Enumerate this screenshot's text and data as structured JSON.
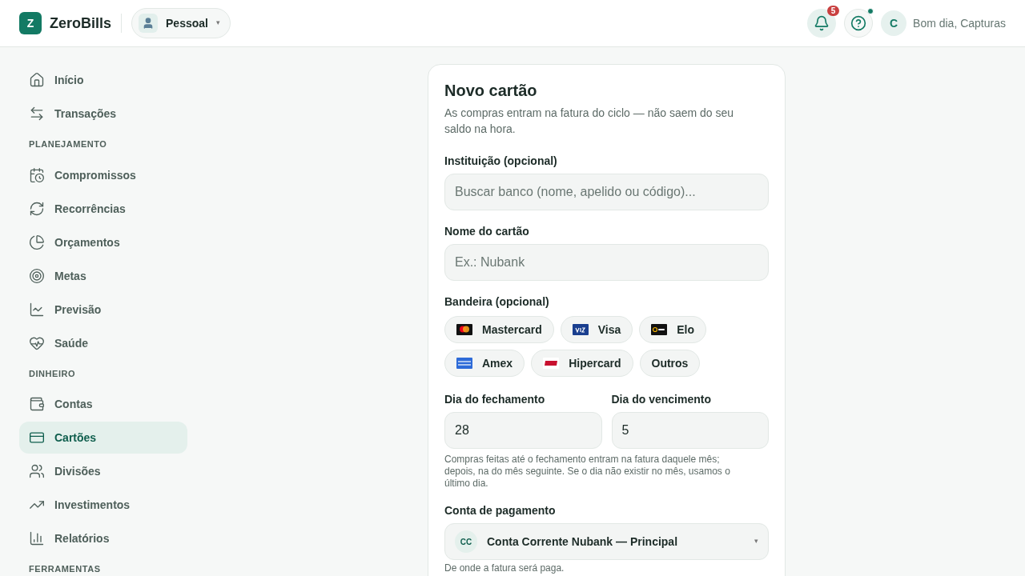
{
  "header": {
    "logo_letter": "Z",
    "app_name": "ZeroBills",
    "profile": {
      "label": "Pessoal",
      "caret": "▾"
    },
    "notifications": {
      "count": "5"
    },
    "help": {
      "has_dot": true
    },
    "user": {
      "initial": "C",
      "greeting": "Bom dia, Capturas"
    }
  },
  "sidebar": {
    "sections": [
      {
        "items": [
          {
            "label": "Início",
            "selected": false
          },
          {
            "label": "Transações",
            "selected": false
          }
        ]
      },
      {
        "title": "PLANEJAMENTO",
        "items": [
          {
            "label": "Compromissos",
            "selected": false
          },
          {
            "label": "Recorrências",
            "selected": false
          },
          {
            "label": "Orçamentos",
            "selected": false
          },
          {
            "label": "Metas",
            "selected": false
          },
          {
            "label": "Previsão",
            "selected": false
          },
          {
            "label": "Saúde",
            "selected": false
          }
        ]
      },
      {
        "title": "DINHEIRO",
        "items": [
          {
            "label": "Contas",
            "selected": false
          },
          {
            "label": "Cartões",
            "selected": true
          },
          {
            "label": "Divisões",
            "selected": false
          },
          {
            "label": "Investimentos",
            "selected": false
          },
          {
            "label": "Relatórios",
            "selected": false
          }
        ]
      },
      {
        "title": "FERRAMENTAS"
      }
    ]
  },
  "form": {
    "title": "Novo cartão",
    "subtitle": "As compras entram na fatura do ciclo — não saem do seu saldo na hora.",
    "institution": {
      "label": "Instituição (opcional)",
      "placeholder": "Buscar banco (nome, apelido ou código)..."
    },
    "name": {
      "label": "Nome do cartão",
      "placeholder": "Ex.: Nubank"
    },
    "brand": {
      "label": "Bandeira (opcional)",
      "options": [
        {
          "label": "Mastercard",
          "kind": "mastercard",
          "selected": false
        },
        {
          "label": "Visa",
          "kind": "visa",
          "selected": false
        },
        {
          "label": "Elo",
          "kind": "elo",
          "selected": false
        },
        {
          "label": "Amex",
          "kind": "amex",
          "selected": false
        },
        {
          "label": "Hipercard",
          "kind": "hipercard",
          "selected": false
        },
        {
          "label": "Outros",
          "kind": "none",
          "selected": false
        }
      ]
    },
    "closing_day": {
      "label": "Dia do fechamento",
      "value": "28"
    },
    "due_day": {
      "label": "Dia do vencimento",
      "value": "5"
    },
    "days_hint": "Compras feitas até o fechamento entram na fatura daquele mês; depois, na do mês seguinte. Se o dia não existir no mês, usamos o último dia.",
    "payment_account": {
      "label": "Conta de pagamento",
      "badge": "CC",
      "value": "Conta Corrente Nubank — Principal",
      "caret": "▾",
      "hint": "De onde a fatura será paga."
    }
  }
}
